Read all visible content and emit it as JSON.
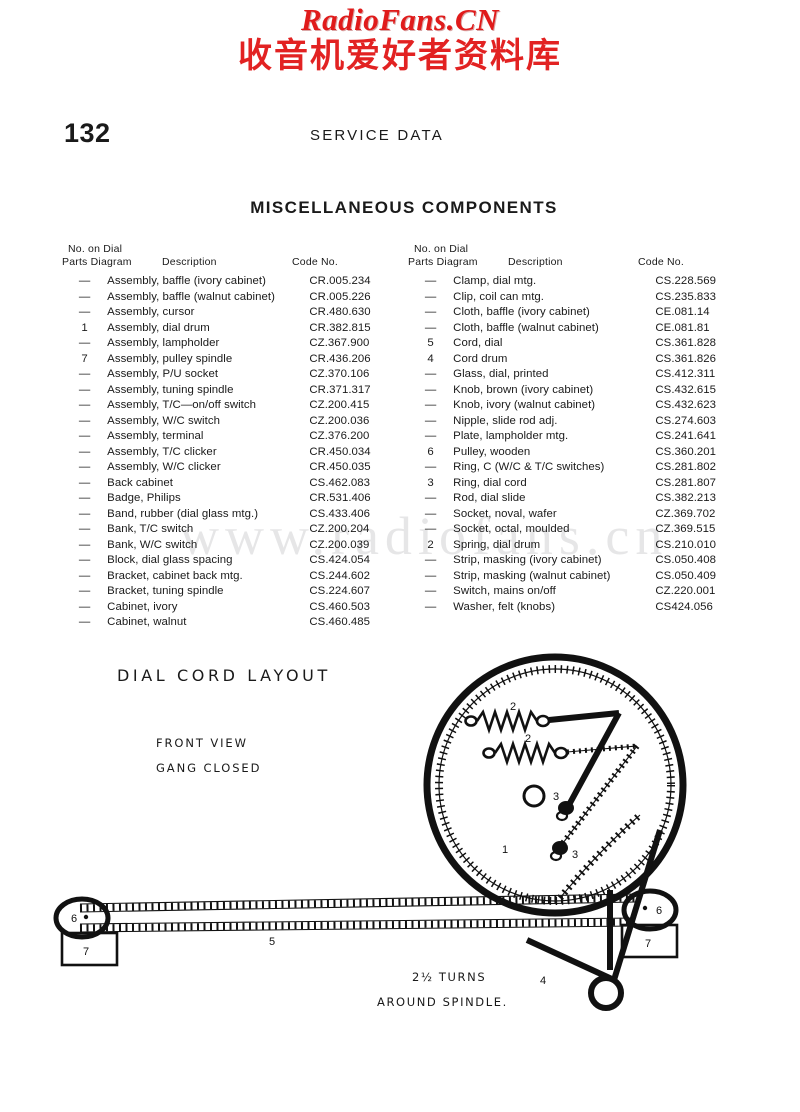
{
  "watermark": {
    "latin": "RadioFans.CN",
    "cjk": "收音机爱好者资料库",
    "faint": "www.radiofans.cn",
    "accent_color": "#e01b1b"
  },
  "header": {
    "page_number": "132",
    "running_head": "SERVICE  DATA",
    "section_title": "MISCELLANEOUS  COMPONENTS"
  },
  "table": {
    "headers": {
      "line1": "No. on Dial",
      "parts_diagram": "Parts Diagram",
      "description": "Description",
      "code_no": "Code No."
    },
    "left_rows": [
      {
        "no": "—",
        "desc": "Assembly, baffle  (ivory cabinet)",
        "code": "CR.005.234"
      },
      {
        "no": "—",
        "desc": "Assembly, baffle  (walnut cabinet)",
        "code": "CR.005.226"
      },
      {
        "no": "—",
        "desc": "Assembly,  cursor",
        "code": "CR.480.630"
      },
      {
        "no": "1",
        "desc": "Assembly, dial drum",
        "code": "CR.382.815"
      },
      {
        "no": "—",
        "desc": "Assembly,  lampholder",
        "code": "CZ.367.900"
      },
      {
        "no": "7",
        "desc": "Assembly,  pulley  spindle",
        "code": "CR.436.206"
      },
      {
        "no": "—",
        "desc": "Assembly,  P/U socket",
        "code": "CZ.370.106"
      },
      {
        "no": "—",
        "desc": "Assembly,  tuning  spindle",
        "code": "CR.371.317"
      },
      {
        "no": "—",
        "desc": "Assembly,  T/C—on/off  switch",
        "code": "CZ.200.415"
      },
      {
        "no": "—",
        "desc": "Assembly,  W/C switch",
        "code": "CZ.200.036"
      },
      {
        "no": "—",
        "desc": "Assembly,  terminal",
        "code": "CZ.376.200"
      },
      {
        "no": "—",
        "desc": "Assembly,  T/C  clicker",
        "code": "CR.450.034"
      },
      {
        "no": "—",
        "desc": "Assembly,  W/C clicker",
        "code": "CR.450.035"
      },
      {
        "no": "—",
        "desc": "Back   cabinet",
        "code": "CS.462.083"
      },
      {
        "no": "—",
        "desc": "Badge,  Philips",
        "code": "CR.531.406"
      },
      {
        "no": "—",
        "desc": "Band, rubber  (dial glass mtg.)",
        "code": "CS.433.406"
      },
      {
        "no": "—",
        "desc": "Bank,  T/C switch",
        "code": "CZ.200.204"
      },
      {
        "no": "—",
        "desc": "Bank,  W/C switch",
        "code": "CZ.200.039"
      },
      {
        "no": "—",
        "desc": "Block, dial glass spacing",
        "code": "CS.424.054"
      },
      {
        "no": "—",
        "desc": "Bracket, cabinet back mtg.",
        "code": "CS.244.602"
      },
      {
        "no": "—",
        "desc": "Bracket, tuning spindle",
        "code": "CS.224.607"
      },
      {
        "no": "—",
        "desc": "Cabinet, ivory",
        "code": "CS.460.503"
      },
      {
        "no": "—",
        "desc": "Cabinet, walnut",
        "code": "CS.460.485"
      }
    ],
    "right_rows": [
      {
        "no": "—",
        "desc": "Clamp, dial  mtg.",
        "code": "CS.228.569"
      },
      {
        "no": "—",
        "desc": "Clip,  coil  can  mtg.",
        "code": "CS.235.833"
      },
      {
        "no": "—",
        "desc": "Cloth, baffle  (ivory cabinet)",
        "code": "CE.081.14"
      },
      {
        "no": "—",
        "desc": "Cloth, baffle  (walnut cabinet)",
        "code": "CE.081.81"
      },
      {
        "no": "5",
        "desc": "Cord,  dial",
        "code": "CS.361.828"
      },
      {
        "no": "4",
        "desc": "Cord  drum",
        "code": "CS.361.826"
      },
      {
        "no": "—",
        "desc": "Glass,  dial,  printed",
        "code": "CS.412.311"
      },
      {
        "no": "—",
        "desc": "Knob,  brown   (ivory  cabinet)",
        "code": "CS.432.615"
      },
      {
        "no": "—",
        "desc": "Knob, ivory  (walnut cabinet)",
        "code": "CS.432.623"
      },
      {
        "no": "—",
        "desc": "Nipple,  slide  rod  adj.",
        "code": "CS.274.603"
      },
      {
        "no": "—",
        "desc": "Plate,  lampholder  mtg.",
        "code": "CS.241.641"
      },
      {
        "no": "6",
        "desc": "Pulley,  wooden",
        "code": "CS.360.201"
      },
      {
        "no": "—",
        "desc": "Ring,  C  (W/C & T/C switches)",
        "code": "CS.281.802"
      },
      {
        "no": "3",
        "desc": "Ring,  dial cord",
        "code": "CS.281.807"
      },
      {
        "no": "—",
        "desc": "Rod, dial  slide",
        "code": "CS.382.213"
      },
      {
        "no": "—",
        "desc": "Socket,  noval,  wafer",
        "code": "CZ.369.702"
      },
      {
        "no": "—",
        "desc": "Socket,  octal,  moulded",
        "code": "CZ.369.515"
      },
      {
        "no": "2",
        "desc": "Spring,  dial  drum",
        "code": "CS.210.010"
      },
      {
        "no": "—",
        "desc": "Strip,  masking  (ivory cabinet)",
        "code": "CS.050.408"
      },
      {
        "no": "—",
        "desc": "Strip,  masking  (walnut cabinet)",
        "code": "CS.050.409"
      },
      {
        "no": "—",
        "desc": "Switch,  mains on/off",
        "code": "CZ.220.001"
      },
      {
        "no": "—",
        "desc": "Washer,  felt  (knobs)",
        "code": "CS424.056"
      }
    ]
  },
  "diagram": {
    "title": "DIAL  CORD  LAYOUT",
    "subtitle_1": "FRONT  VIEW",
    "subtitle_2": "GANG CLOSED",
    "caption_1": "2½  TURNS",
    "caption_2": "AROUND  SPINDLE.",
    "callouts": {
      "drum": "1",
      "spring_upper": "2",
      "spring_lower": "2",
      "ring_upper": "3",
      "ring_lower": "3",
      "cord_drum": "4",
      "cord_dial": "5",
      "pulley_left": "6",
      "pulley_right": "6",
      "bracket_left": "7",
      "bracket_right": "7"
    }
  }
}
